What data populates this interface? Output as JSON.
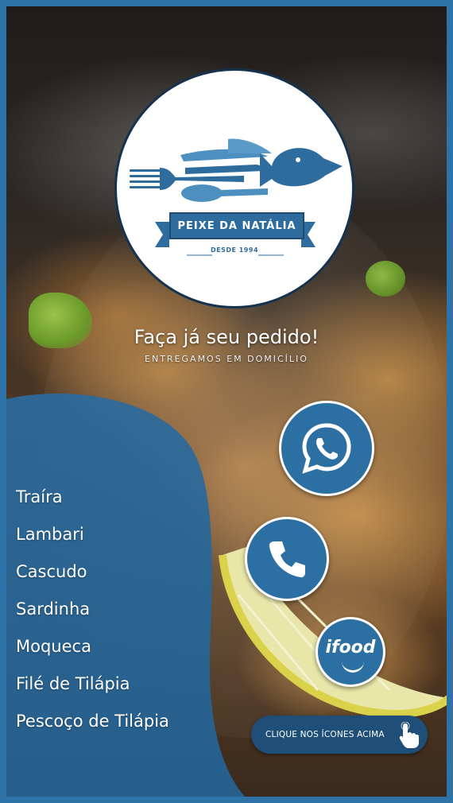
{
  "brand": {
    "name": "PEIXE DA NATÁLIA",
    "since": "DESDE 1994",
    "colors": {
      "primary": "#2c6fa3",
      "dark": "#1f4f78",
      "frame": "#2d73a8",
      "panel": "#2a6698"
    }
  },
  "cta": {
    "title": "Faça já seu pedido!",
    "subtitle": "ENTREGAMOS EM DOMICÍLIO"
  },
  "menu": {
    "items": [
      "Traíra",
      "Lambari",
      "Cascudo",
      "Sardinha",
      "Moqueca",
      "Filé de Tilápia",
      "Pescoço de Tilápia"
    ]
  },
  "contacts": {
    "whatsapp_icon": "whatsapp-icon",
    "phone_icon": "phone-icon",
    "ifood_label": "ifood"
  },
  "hint": {
    "label": "CLIQUE NOS ÍCONES ACIMA",
    "icon": "pointing-hand-icon"
  }
}
